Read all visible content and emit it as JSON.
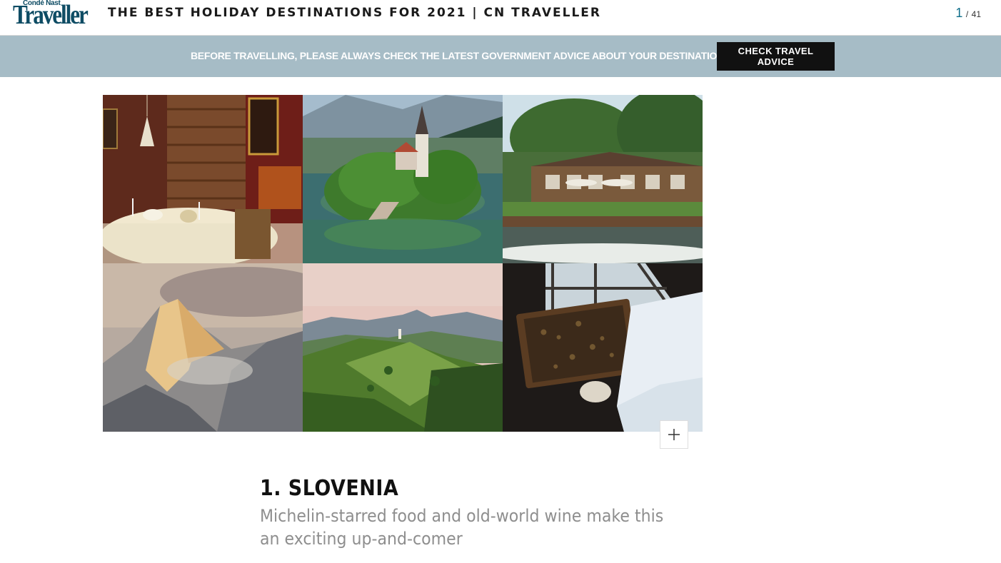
{
  "header": {
    "logo_small": "Condé Nast",
    "logo_big": "Traveller",
    "title": "THE BEST HOLIDAY DESTINATIONS FOR 2021 | CN TRAVELLER",
    "counter_current": "1",
    "counter_separator": "/",
    "counter_total": "41"
  },
  "banner": {
    "text": "BEFORE TRAVELLING, PLEASE ALWAYS CHECK THE LATEST GOVERNMENT ADVICE ABOUT YOUR DESTINATION",
    "button_label": "CHECK TRAVEL ADVICE"
  },
  "gallery": {
    "expand_icon": "plus-icon"
  },
  "slide": {
    "title": "1. SLOVENIA",
    "dek": "Michelin-starred food and old-world wine make this an exciting up-and-comer"
  },
  "colors": {
    "brand": "#0e4c64",
    "banner_bg": "#a6bcc6",
    "button_bg": "#111111",
    "dek_text": "#8e8e8e"
  }
}
